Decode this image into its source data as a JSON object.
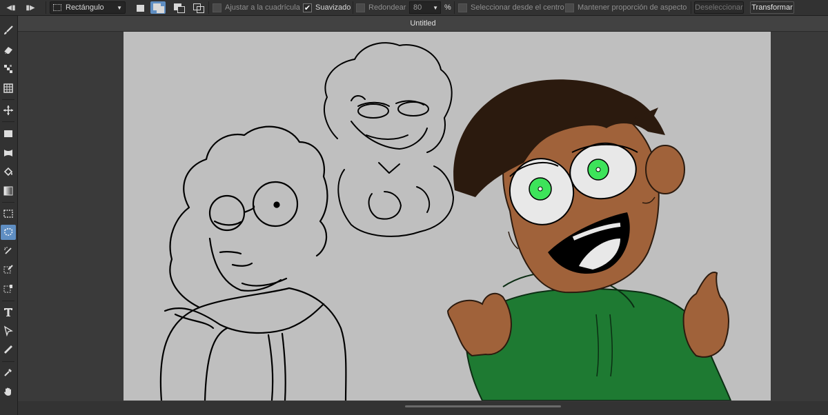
{
  "toolbar_top": {
    "shape_select": {
      "value": "Rectángulo"
    },
    "snap_grid": {
      "label": "Ajustar a la cuadrícula",
      "checked": false
    },
    "antialias": {
      "label": "Suavizado",
      "checked": true
    },
    "round": {
      "label": "Redondear",
      "checked": false,
      "value": "80",
      "unit": "%"
    },
    "from_center": {
      "label": "Seleccionar desde el centro",
      "checked": false
    },
    "keep_ratio": {
      "label": "Mantener proporción de aspecto",
      "checked": false
    },
    "deselect_label": "Deseleccionar",
    "transform_label": "Transformar"
  },
  "document": {
    "title": "Untitled"
  },
  "tools": [
    "brush-icon",
    "eraser-icon",
    "pixel-pattern-icon",
    "grid-icon",
    "move-icon",
    "rectangle-icon",
    "warp-icon",
    "fill-bucket-icon",
    "gradient-icon",
    "marquee-select-icon",
    "lasso-select-icon",
    "magic-wand-icon",
    "selection-pen-icon",
    "selection-eraser-icon",
    "text-icon",
    "pointer-icon",
    "ruler-icon",
    "eyedropper-icon",
    "hand-icon"
  ],
  "active_tool": "lasso-select-icon",
  "colors": {
    "accent": "#5f8ec2",
    "canvas": "#bfbfbf",
    "skin": "#a0623a",
    "hair": "#2b1a0e",
    "hoodie": "#1e7a32",
    "eyes": "#3de35a"
  }
}
